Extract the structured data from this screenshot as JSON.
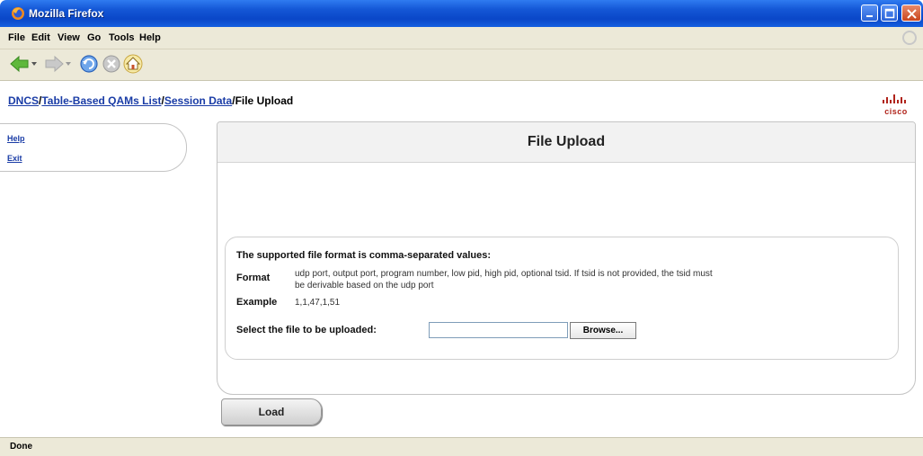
{
  "window": {
    "title": "Mozilla Firefox"
  },
  "menu": [
    "File",
    "Edit",
    "View",
    "Go",
    "Tools",
    "Help"
  ],
  "breadcrumb": {
    "links": [
      "DNCS",
      "Table-Based QAMs List",
      "Session Data"
    ],
    "separator": "/",
    "current": "File Upload"
  },
  "logo": {
    "text": "cisco"
  },
  "sidebar": {
    "items": [
      "Help",
      "Exit"
    ]
  },
  "panel": {
    "title": "File Upload",
    "heading": "The supported file format is comma-separated values:",
    "format_label": "Format",
    "format_text_1": "udp port, output port, program number, low pid, high pid, optional tsid. If tsid is not provided, the tsid must",
    "format_text_2": "be derivable based on the udp port",
    "example_label": "Example",
    "example_value": "1,1,47,1,51",
    "select_label": "Select the file to be uploaded:",
    "file_value": "",
    "browse_label": "Browse..."
  },
  "load_label": "Load",
  "status": "Done",
  "colors": {
    "link": "#1a3ca6",
    "titlebar": "#0a47c8",
    "chrome": "#ece9d8",
    "cisco": "#b0231a"
  }
}
